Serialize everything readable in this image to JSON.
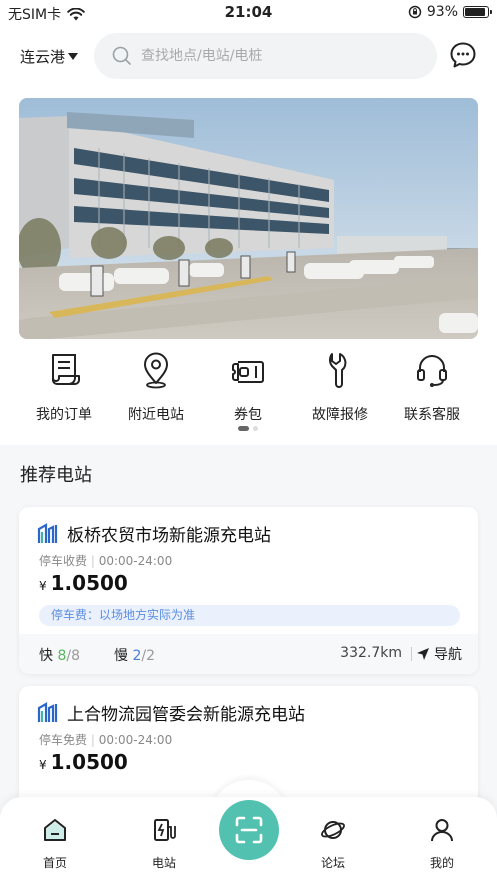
{
  "status_bar": {
    "carrier": "无SIM卡",
    "time": "21:04",
    "battery": "93%",
    "battery_level": 0.93
  },
  "header": {
    "city": "连云港",
    "search_placeholder": "查找地点/电站/电桩"
  },
  "menu": [
    {
      "label": "我的订单",
      "icon": "order-icon"
    },
    {
      "label": "附近电站",
      "icon": "location-icon"
    },
    {
      "label": "券包",
      "icon": "coupon-icon"
    },
    {
      "label": "故障报修",
      "icon": "wrench-icon"
    },
    {
      "label": "联系客服",
      "icon": "headset-icon"
    }
  ],
  "section_title": "推荐电站",
  "stations": [
    {
      "name": "板桥农贸市场新能源充电站",
      "parking": "停车收费",
      "hours": "00:00-24:00",
      "currency": "¥",
      "price": "1.0500",
      "parking_fee_note": "停车费：以场地方实际为准",
      "fast_label": "快",
      "fast_available": "8",
      "fast_total": "/8",
      "slow_label": "慢",
      "slow_available": "2",
      "slow_total": "/2",
      "distance": "332.7km",
      "nav_label": "导航"
    },
    {
      "name": "上合物流园管委会新能源充电站",
      "parking": "停车免费",
      "hours": "00:00-24:00",
      "currency": "¥",
      "price": "1.0500"
    }
  ],
  "tabs": [
    {
      "label": "首页",
      "icon": "home-icon"
    },
    {
      "label": "电站",
      "icon": "charger-icon"
    },
    {
      "label": "论坛",
      "icon": "planet-icon"
    },
    {
      "label": "我的",
      "icon": "user-icon"
    }
  ],
  "colors": {
    "accent": "#52c1b0",
    "fast": "#5ab65e",
    "slow": "#4a7fd6",
    "fee_bg": "#eaf1fc",
    "fee_text": "#5b8de0"
  }
}
